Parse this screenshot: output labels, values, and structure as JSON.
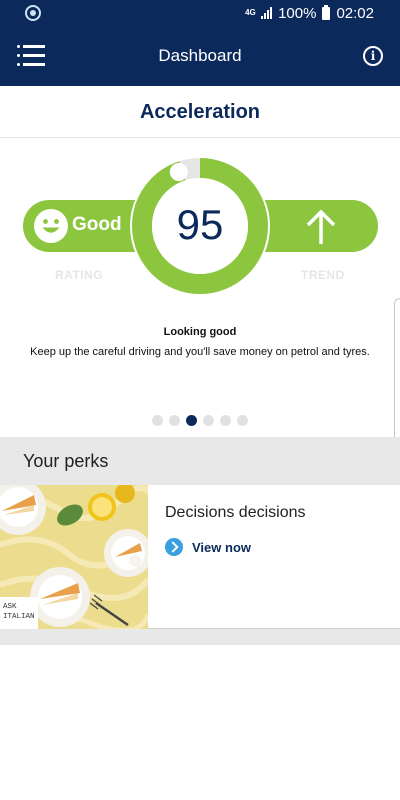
{
  "status_bar": {
    "network": "4G",
    "battery": "100%",
    "time": "02:02"
  },
  "app_bar": {
    "title": "Dashboard"
  },
  "section": {
    "title": "Acceleration"
  },
  "score": {
    "value": "95",
    "rating_label": "Good",
    "rating_caption": "RATING",
    "trend_caption": "TREND",
    "gauge_fill_percent": 95,
    "accent_color": "#8cc63f"
  },
  "message": {
    "title": "Looking good",
    "body": "Keep up the careful driving and you'll save money on petrol and tyres."
  },
  "pagination": {
    "total": 6,
    "active_index": 2
  },
  "perks": {
    "header": "Your perks",
    "card": {
      "title": "Decisions decisions",
      "link_label": "View now",
      "logo_line1": "ASK",
      "logo_line2": "ITALIAN"
    }
  },
  "colors": {
    "navy": "#0b2a5b",
    "green": "#8cc63f",
    "link_blue": "#3aa0e0"
  },
  "icons": {
    "menu": "hamburger-icon",
    "info": "info-icon",
    "rating": "smiley-icon",
    "trend": "arrow-up-icon",
    "link": "chevron-right-icon"
  }
}
